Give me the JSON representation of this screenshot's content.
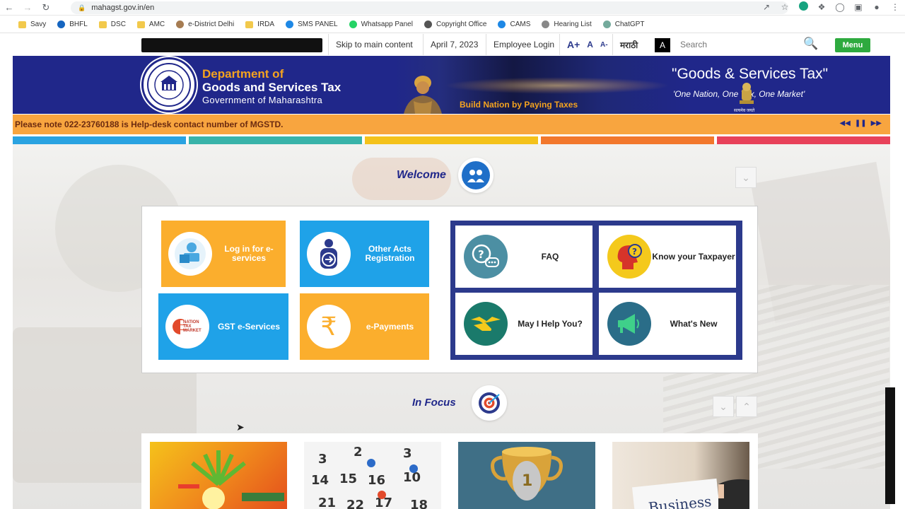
{
  "browser": {
    "url": "mahagst.gov.in/en",
    "bookmarks": [
      {
        "label": "Savy",
        "icon": "folder-icon",
        "color": "#f2c94c"
      },
      {
        "label": "BHFL",
        "icon": "site-icon",
        "color": "#1565c0"
      },
      {
        "label": "DSC",
        "icon": "folder-icon",
        "color": "#f2c94c"
      },
      {
        "label": "AMC",
        "icon": "folder-icon",
        "color": "#f2c94c"
      },
      {
        "label": "e-District Delhi",
        "icon": "emblem-icon",
        "color": "#a67c52"
      },
      {
        "label": "IRDA",
        "icon": "folder-icon",
        "color": "#f2c94c"
      },
      {
        "label": "SMS PANEL",
        "icon": "mail-icon",
        "color": "#1e88e5"
      },
      {
        "label": "Whatsapp Panel",
        "icon": "whatsapp-icon",
        "color": "#25d366"
      },
      {
        "label": "Copyright Office",
        "icon": "globe-icon",
        "color": "#555555"
      },
      {
        "label": "CAMS",
        "icon": "cams-icon",
        "color": "#1e88e5"
      },
      {
        "label": "Hearing List",
        "icon": "emblem-icon",
        "color": "#888888"
      },
      {
        "label": "ChatGPT",
        "icon": "chatgpt-icon",
        "color": "#74aa9c"
      }
    ]
  },
  "utility": {
    "skip": "Skip to main content",
    "date": "April 7, 2023",
    "employee_login": "Employee Login",
    "font_larger": "A+",
    "font_normal": "A",
    "font_smaller": "A-",
    "language": "मराठी",
    "contrast": "A",
    "search_placeholder": "Search",
    "menu": "Menu"
  },
  "banner": {
    "dept_line1": "Department of",
    "dept_line2": "Goods and Services Tax",
    "dept_line3": "Government of Maharashtra",
    "seal_text": "GOVT OF MAHARASHTRA",
    "build_nation": "Build Nation by Paying Taxes",
    "gst_quote": "\"Goods & Services Tax\"",
    "gst_sub": "'One Nation, One Tax, One Market'",
    "emblem_text": "सत्यमेव जयते"
  },
  "ticker": {
    "text": "Please note 022-23760188 is Help-desk contact number of MGSTD."
  },
  "colors": {
    "brand_blue": "#20278a",
    "accent_orange": "#f8a53f",
    "strip": [
      "#2aa3e1",
      "#39b3a9",
      "#f4c21b",
      "#f2782c",
      "#e8425a"
    ]
  },
  "welcome": {
    "title": "Welcome",
    "tiles": [
      {
        "label": "Log in for e-services"
      },
      {
        "label": "Other Acts Registration"
      },
      {
        "label": "GST e-Services",
        "logo_text": "NATION TAX MARKET"
      },
      {
        "label": "e-Payments"
      }
    ],
    "help": [
      {
        "label": "FAQ"
      },
      {
        "label": "Know your Taxpayer"
      },
      {
        "label": "May I Help You?"
      },
      {
        "label": "What's New"
      }
    ]
  },
  "in_focus": {
    "title": "In Focus"
  }
}
